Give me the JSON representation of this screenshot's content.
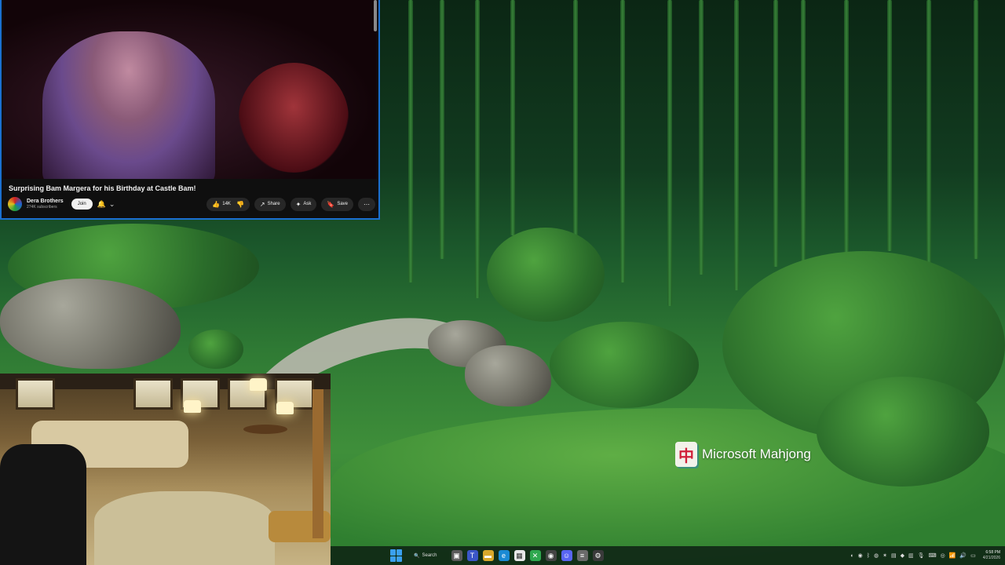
{
  "desktop": {
    "mahjong_shortcut_label": "Microsoft Mahjong",
    "mahjong_tile_glyph": "中"
  },
  "youtube": {
    "video_title": "Surprising Bam Margera for his Birthday at Castle Bam!",
    "channel_name": "Dera Brothers",
    "subscribers": "274K subscribers",
    "join_label": "Join",
    "bell_icon": "bell-icon",
    "like_count": "14K",
    "share_label": "Share",
    "ask_label": "Ask",
    "save_label": "Save",
    "more_icon": "more-icon"
  },
  "taskbar": {
    "search_label": "Search",
    "clock_time": "6:58 PM",
    "clock_date": "4/21/2026"
  },
  "colors": {
    "window_border": "#1a6fd0",
    "start_accent": "#3aa0f0",
    "mahjong_red": "#d0203a"
  }
}
